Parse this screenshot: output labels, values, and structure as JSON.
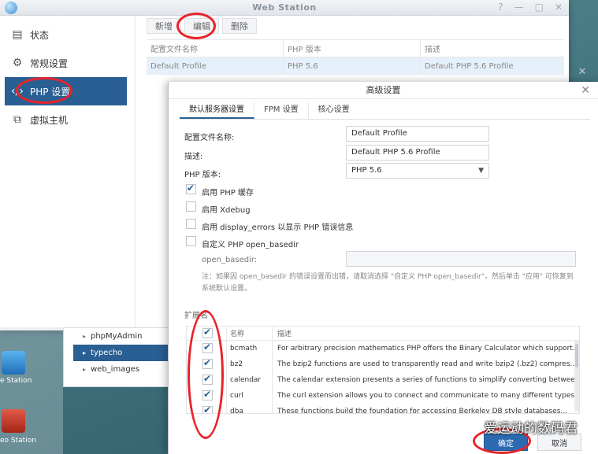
{
  "window": {
    "title": "Web Station",
    "controls": [
      "?",
      "—",
      "▢",
      "✕"
    ]
  },
  "sidebar": {
    "items": [
      {
        "label": "状态",
        "icon": "status-icon"
      },
      {
        "label": "常规设置",
        "icon": "gear-icon"
      },
      {
        "label": "PHP 设置",
        "icon": "code-icon",
        "active": true
      },
      {
        "label": "虚拟主机",
        "icon": "vhost-icon"
      }
    ]
  },
  "toolbar": {
    "create": "新增",
    "edit": "编辑",
    "delete": "删除"
  },
  "profiles": {
    "headers": [
      "配置文件名称",
      "PHP 版本",
      "描述"
    ],
    "rows": [
      {
        "name": "Default Profile",
        "php": "PHP 5.6",
        "desc": "Default PHP 5.6 Profile"
      }
    ]
  },
  "desktop": {
    "apps": [
      {
        "label": "e Station",
        "icon": "web-station-icon"
      },
      {
        "label": "eo Station",
        "icon": "video-station-icon"
      }
    ],
    "folders": [
      {
        "label": "phpMyAdmin",
        "selected": false
      },
      {
        "label": "typecho",
        "selected": true
      },
      {
        "label": "web_images",
        "selected": false
      }
    ]
  },
  "dialog": {
    "title": "高级设置",
    "tabs": [
      "默认服务器设置",
      "FPM 设置",
      "核心设置"
    ],
    "fields": {
      "profile_name_label": "配置文件名称:",
      "profile_name_value": "Default Profile",
      "desc_label": "描述:",
      "desc_value": "Default PHP 5.6 Profile",
      "php_label": "PHP 版本:",
      "php_value": "PHP 5.6",
      "open_basedir_label": "open_basedir:",
      "open_basedir_value": ""
    },
    "checkboxes": [
      {
        "label": "启用 PHP 缓存",
        "checked": true
      },
      {
        "label": "启用 Xdebug",
        "checked": false
      },
      {
        "label": "启用 display_errors 以显示 PHP 错误信息",
        "checked": false
      },
      {
        "label": "自定义 PHP open_basedir",
        "checked": false
      }
    ],
    "note": "注：如果因 open_basedir 的错误设置而出错，请取消选择 \"自定义 PHP open_basedir\"，然后单击 \"应用\" 可恢复到系统默认设置。",
    "extensions_title": "扩展名",
    "ext_headers": {
      "name": "名称",
      "desc": "描述"
    },
    "extensions": [
      {
        "name": "bcmath",
        "desc": "For arbitrary precision mathematics PHP offers the Binary Calculator which support...",
        "checked": true
      },
      {
        "name": "bz2",
        "desc": "The bzip2 functions are used to transparently read and write bzip2 (.bz2) compres...",
        "checked": true
      },
      {
        "name": "calendar",
        "desc": "The calendar extension presents a series of functions to simplify converting betwee...",
        "checked": true
      },
      {
        "name": "curl",
        "desc": "The curl extension allows you to connect and communicate to many different types...",
        "checked": true
      },
      {
        "name": "dba",
        "desc": "These functions build the foundation for accessing Berkeley DB style databases...",
        "checked": true
      }
    ],
    "ok": "确定",
    "cancel": "取消"
  },
  "watermark": "爱运动的数码君",
  "colors": {
    "accent": "#2a5f93",
    "ok_button": "#2b6ab0",
    "annotation": "#e8242a"
  }
}
